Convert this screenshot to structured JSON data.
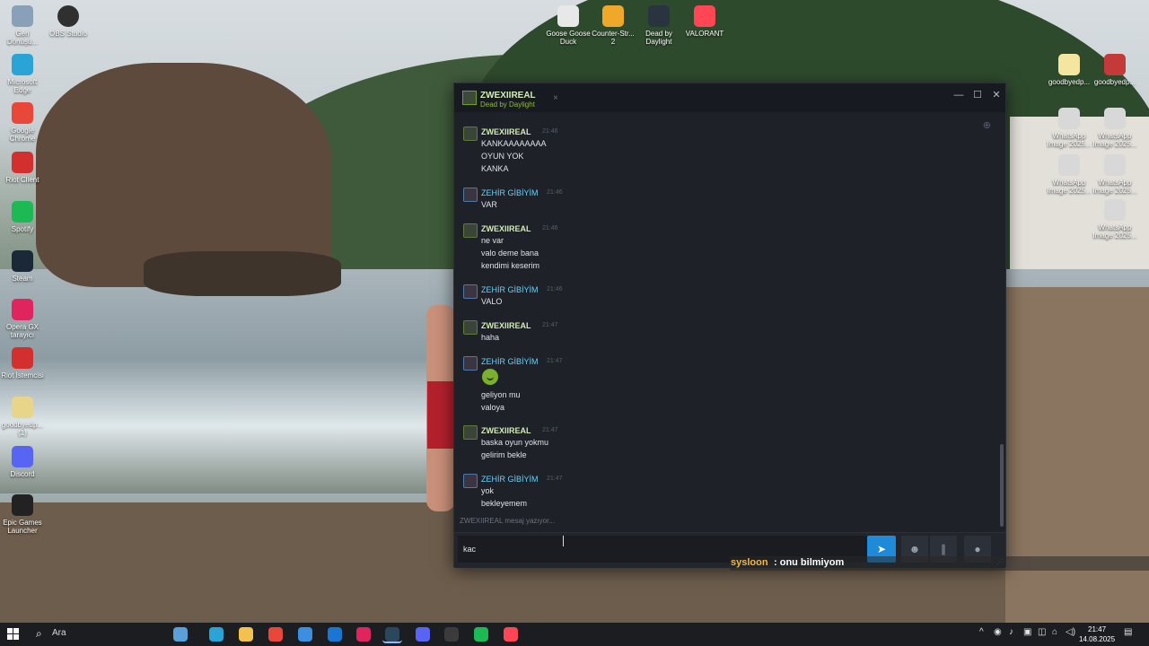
{
  "desktop": {
    "icons_left": [
      {
        "label": "Geri Dönüşü...",
        "color": "#8aa0b8",
        "icon": "recycle-bin-icon"
      },
      {
        "label": "Microsoft Edge",
        "color": "#2aa3d6",
        "icon": "edge-icon"
      },
      {
        "label": "Google Chrome",
        "color": "#e9473a",
        "icon": "chrome-icon"
      },
      {
        "label": "Riot Client",
        "color": "#d32f2f",
        "icon": "riot-client-icon"
      },
      {
        "label": "Spotify",
        "color": "#1db954",
        "icon": "spotify-icon"
      },
      {
        "label": "Steam",
        "color": "#1b2838",
        "icon": "steam-icon"
      },
      {
        "label": "Opera GX tarayıcı",
        "color": "#e0245e",
        "icon": "opera-gx-icon"
      },
      {
        "label": "Riot İstemcisi",
        "color": "#d32f2f",
        "icon": "riot-istemcisi-icon"
      },
      {
        "label": "goodbyedp... (1)",
        "color": "#e8d58a",
        "icon": "folder-icon"
      },
      {
        "label": "Discord",
        "color": "#5865f2",
        "icon": "discord-icon"
      },
      {
        "label": "Epic Games Launcher",
        "color": "#222222",
        "icon": "epic-games-icon"
      }
    ],
    "obs_label": "OBS Studio",
    "icons_top": [
      {
        "label": "Goose Goose Duck",
        "color": "#e8e8e8",
        "icon": "goose-goose-duck-icon"
      },
      {
        "label": "Counter-Str... 2",
        "color": "#f0a82a",
        "icon": "counter-strike-icon"
      },
      {
        "label": "Dead by Daylight",
        "color": "#2a3440",
        "icon": "dead-by-daylight-icon"
      },
      {
        "label": "VALORANT",
        "color": "#ff4655",
        "icon": "valorant-icon"
      }
    ],
    "icons_right": [
      {
        "label": "goodbyedp...",
        "color": "#f4e6a0",
        "icon": "file-icon"
      },
      {
        "label": "goodbyedp...",
        "color": "#c43a3a",
        "icon": "winrar-icon"
      },
      {
        "label": "WhatsApp Image 2025...",
        "color": "#d8d8d8",
        "icon": "image-icon"
      },
      {
        "label": "WhatsApp Image 2025...",
        "color": "#d8d8d8",
        "icon": "image-icon"
      },
      {
        "label": "WhatsApp Image 2025...",
        "color": "#d8d8d8",
        "icon": "image-icon"
      },
      {
        "label": "WhatsApp Image 2025...",
        "color": "#d8d8d8",
        "icon": "image-icon"
      },
      {
        "label": "WhatsApp Image 2025...",
        "color": "#d8d8d8",
        "icon": "image-icon"
      }
    ]
  },
  "chat": {
    "friend_name": "ZWEXIIREAL",
    "friend_game": "Dead by Daylight",
    "tab_close": "×",
    "window_controls": {
      "minimize": "—",
      "maximize": "☐",
      "close": "✕"
    },
    "messages": [
      {
        "sender": "ZWEXIIREAL",
        "self": true,
        "time": "21:46",
        "lines": [
          "KANKAAAAAAAA",
          "OYUN YOK",
          "KANKA"
        ]
      },
      {
        "sender": "ZEHİR GİBİYİM",
        "self": false,
        "time": "21:46",
        "lines": [
          "VAR"
        ]
      },
      {
        "sender": "ZWEXIIREAL",
        "self": true,
        "time": "21:46",
        "lines": [
          "ne var",
          "valo deme bana",
          "kendimi keserim"
        ]
      },
      {
        "sender": "ZEHİR GİBİYİM",
        "self": false,
        "time": "21:46",
        "lines": [
          "VALO"
        ]
      },
      {
        "sender": "ZWEXIIREAL",
        "self": true,
        "time": "21:47",
        "lines": [
          "haha"
        ]
      },
      {
        "sender": "ZEHİR GİBİYİM",
        "self": false,
        "time": "21:47",
        "lines": [
          "geliyon mu",
          "valoya"
        ],
        "emoji": "laughing-emoji-icon"
      },
      {
        "sender": "ZWEXIIREAL",
        "self": true,
        "time": "21:47",
        "lines": [
          "baska oyun yokmu",
          "gelirim bekle"
        ]
      },
      {
        "sender": "ZEHİR GİBİYİM",
        "self": false,
        "time": "21:47",
        "lines": [
          "yok",
          "bekleyemem"
        ]
      }
    ],
    "typing_indicator": "ZWEXIIREAL mesaj yazıyor...",
    "input_value": "kac"
  },
  "overlay": {
    "user": "sysloon",
    "text": ": onu bilmiyom"
  },
  "taskbar": {
    "search_label": "Ara",
    "apps": [
      {
        "icon": "widgets-icon",
        "color": "#5aa0d8"
      },
      {
        "icon": "edge-icon",
        "color": "#2aa3d6"
      },
      {
        "icon": "file-explorer-icon",
        "color": "#f2c14e"
      },
      {
        "icon": "chrome-icon",
        "color": "#e9473a"
      },
      {
        "icon": "store-icon",
        "color": "#3c8fe0"
      },
      {
        "icon": "outlook-icon",
        "color": "#1976d2"
      },
      {
        "icon": "opera-gx-icon",
        "color": "#e0245e"
      },
      {
        "icon": "steam-icon",
        "color": "#2a475e",
        "active": true
      },
      {
        "icon": "discord-icon",
        "color": "#5865f2"
      },
      {
        "icon": "obs-icon",
        "color": "#3b3b3b"
      },
      {
        "icon": "spotify-icon",
        "color": "#1db954"
      },
      {
        "icon": "valorant-icon",
        "color": "#ff4655"
      }
    ],
    "time": "21:47",
    "date": "14.08.2025"
  }
}
